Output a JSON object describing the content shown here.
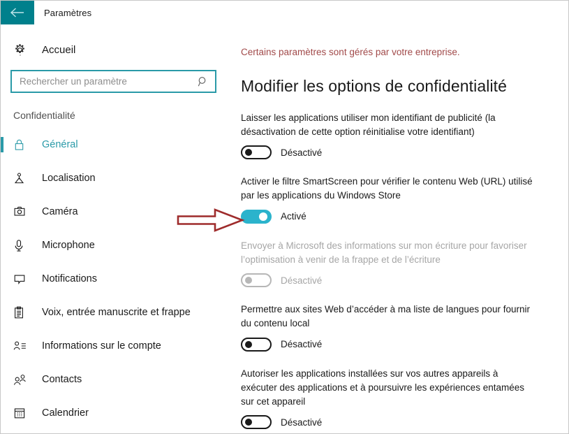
{
  "titlebar": {
    "back_icon": "back-arrow-icon",
    "title": "Paramètres"
  },
  "sidebar": {
    "home": {
      "icon": "gear-icon",
      "label": "Accueil"
    },
    "search": {
      "placeholder": "Rechercher un paramètre",
      "value": "",
      "icon": "search-icon"
    },
    "section_heading": "Confidentialité",
    "items": [
      {
        "icon": "lock-icon",
        "label": "Général",
        "active": true
      },
      {
        "icon": "location-icon",
        "label": "Localisation",
        "active": false
      },
      {
        "icon": "camera-icon",
        "label": "Caméra",
        "active": false
      },
      {
        "icon": "microphone-icon",
        "label": "Microphone",
        "active": false
      },
      {
        "icon": "notification-icon",
        "label": "Notifications",
        "active": false
      },
      {
        "icon": "clipboard-icon",
        "label": "Voix, entrée manuscrite et frappe",
        "active": false
      },
      {
        "icon": "account-info-icon",
        "label": "Informations sur le compte",
        "active": false
      },
      {
        "icon": "contacts-icon",
        "label": "Contacts",
        "active": false
      },
      {
        "icon": "calendar-icon",
        "label": "Calendrier",
        "active": false
      }
    ]
  },
  "content": {
    "enterprise_note": "Certains paramètres sont gérés par votre entreprise.",
    "page_title": "Modifier les options de confidentialité",
    "settings": [
      {
        "description": "Laisser les applications utiliser mon identifiant de publicité (la désactivation de cette option réinitialise votre identifiant)",
        "state_label": "Désactivé",
        "on": false,
        "disabled": false
      },
      {
        "description": "Activer le filtre SmartScreen pour vérifier le contenu Web (URL) utilisé par les applications du Windows Store",
        "state_label": "Activé",
        "on": true,
        "disabled": false
      },
      {
        "description": "Envoyer à Microsoft des informations sur mon écriture pour favoriser l’optimisation à venir de la frappe et de l’écriture",
        "state_label": "Désactivé",
        "on": false,
        "disabled": true
      },
      {
        "description": "Permettre aux sites Web d’accéder à ma liste de langues pour fournir du contenu local",
        "state_label": "Désactivé",
        "on": false,
        "disabled": false
      },
      {
        "description": "Autoriser les applications installées sur vos autres appareils à exécuter des applications et à poursuivre les expériences entamées sur cet appareil",
        "state_label": "Désactivé",
        "on": false,
        "disabled": false
      }
    ]
  },
  "annotation": {
    "icon": "red-arrow-annotation",
    "points_to": "Activé"
  },
  "colors": {
    "accent_teal": "#2a9aa8",
    "titlebar_back": "#00808c",
    "toggle_on": "#2bb3cc",
    "enterprise_note": "#a14a4a",
    "annotation_red": "#9e2b2b"
  }
}
